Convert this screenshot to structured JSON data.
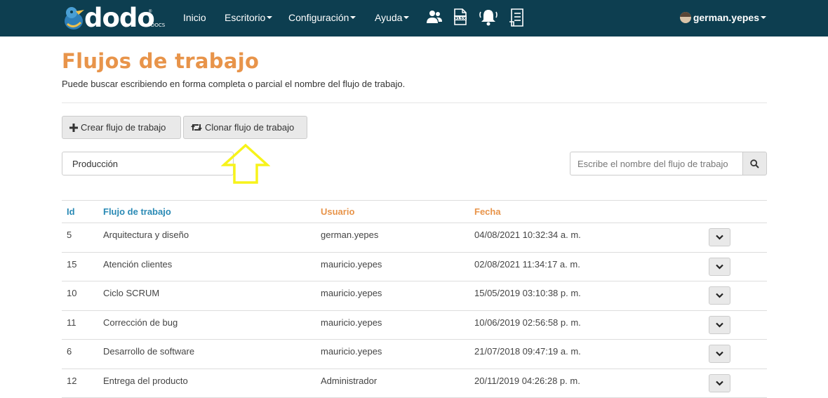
{
  "navbar": {
    "logo_text": "dodo",
    "logo_sub": "DOCS",
    "logo_reg": "®",
    "items": [
      {
        "label": "Inicio",
        "dropdown": false
      },
      {
        "label": "Escritorio",
        "dropdown": true
      },
      {
        "label": "Configuración",
        "dropdown": true
      },
      {
        "label": "Ayuda",
        "dropdown": true
      }
    ],
    "icons": [
      "users-icon",
      "xlsx-file-icon",
      "bell-icon",
      "document-list-icon"
    ],
    "user": "german.yepes",
    "bg_color": "#0d3e50"
  },
  "page": {
    "title": "Flujos de trabajo",
    "subtitle": "Puede buscar escribiendo en forma completa o parcial el nombre del flujo de trabajo.",
    "title_color": "#e8944a"
  },
  "toolbar": {
    "create_label": "Crear flujo de trabajo",
    "clone_label": "Clonar flujo de trabajo"
  },
  "filter": {
    "selected": "Producción"
  },
  "search": {
    "placeholder": "Escribe el nombre del flujo de trabajo"
  },
  "table": {
    "columns": [
      {
        "label": "Id",
        "color": "#2a8ab5"
      },
      {
        "label": "Flujo de trabajo",
        "color": "#2a8ab5"
      },
      {
        "label": "Usuario",
        "color": "#e8944a"
      },
      {
        "label": "Fecha",
        "color": "#e8944a"
      }
    ],
    "rows": [
      {
        "id": "5",
        "flow": "Arquitectura y diseño",
        "user": "german.yepes",
        "date": "04/08/2021 10:32:34 a. m."
      },
      {
        "id": "15",
        "flow": "Atención clientes",
        "user": "mauricio.yepes",
        "date": "02/08/2021 11:34:17 a. m."
      },
      {
        "id": "10",
        "flow": "Ciclo SCRUM",
        "user": "mauricio.yepes",
        "date": "15/05/2019 03:10:38 p. m."
      },
      {
        "id": "11",
        "flow": "Corrección de bug",
        "user": "mauricio.yepes",
        "date": "10/06/2019 02:56:58 p. m."
      },
      {
        "id": "6",
        "flow": "Desarrollo de software",
        "user": "mauricio.yepes",
        "date": "21/07/2018 09:47:19 a. m."
      },
      {
        "id": "12",
        "flow": "Entrega del producto",
        "user": "Administrador",
        "date": "20/11/2019 04:26:28 p. m."
      }
    ]
  },
  "annotation": {
    "arrow_color": "#f7f31a"
  }
}
